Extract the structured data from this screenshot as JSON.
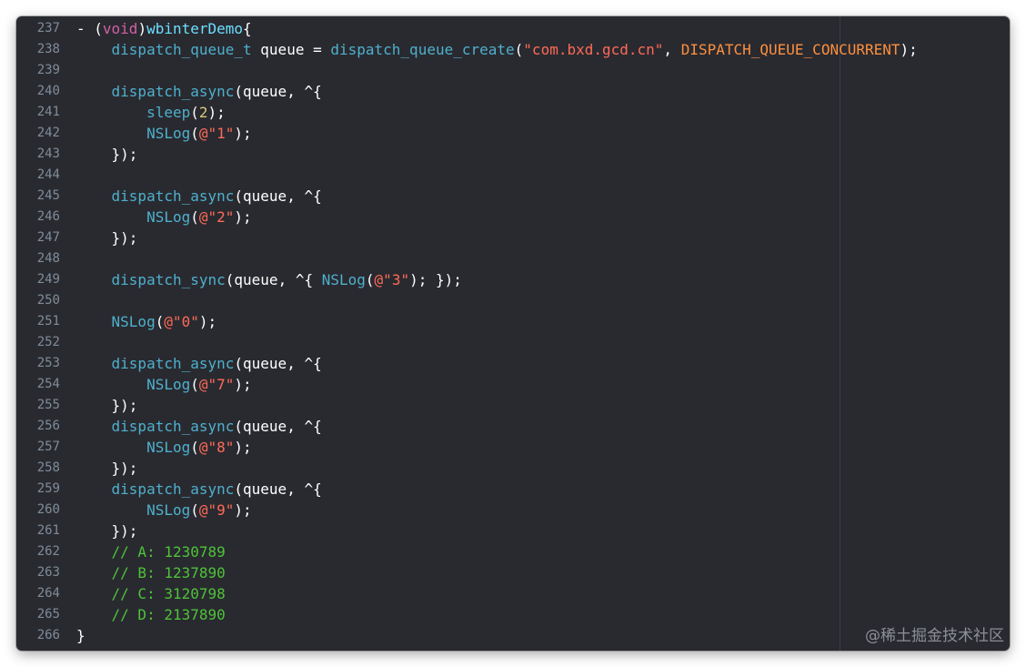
{
  "editor": {
    "watermark": "@稀土掘金技术社区",
    "colors": {
      "background": "#292a30",
      "line_number": "#7f8c98",
      "plain": "#ffffff",
      "function": "#4eb0cc",
      "keyword": "#d35fa8",
      "string": "#ff6a57",
      "number": "#d9c97c",
      "comment": "#4ec338",
      "macro": "#fd8f3f"
    },
    "lines": [
      {
        "n": "237",
        "tokens": [
          {
            "t": "- (",
            "c": "plain"
          },
          {
            "t": "void",
            "c": "keyword"
          },
          {
            "t": ")",
            "c": "plain"
          },
          {
            "t": "wbinterDemo",
            "c": "decl"
          },
          {
            "t": "{",
            "c": "plain"
          }
        ]
      },
      {
        "n": "238",
        "tokens": [
          {
            "t": "    ",
            "c": "plain"
          },
          {
            "t": "dispatch_queue_t",
            "c": "func"
          },
          {
            "t": " queue = ",
            "c": "plain"
          },
          {
            "t": "dispatch_queue_create",
            "c": "func"
          },
          {
            "t": "(",
            "c": "plain"
          },
          {
            "t": "\"com.bxd.gcd.cn\"",
            "c": "string"
          },
          {
            "t": ", ",
            "c": "plain"
          },
          {
            "t": "DISPATCH_QUEUE_CONCURRENT",
            "c": "macro"
          },
          {
            "t": ");",
            "c": "plain"
          }
        ]
      },
      {
        "n": "239",
        "tokens": []
      },
      {
        "n": "240",
        "tokens": [
          {
            "t": "    ",
            "c": "plain"
          },
          {
            "t": "dispatch_async",
            "c": "func"
          },
          {
            "t": "(queue, ^{",
            "c": "plain"
          }
        ]
      },
      {
        "n": "241",
        "tokens": [
          {
            "t": "        ",
            "c": "plain"
          },
          {
            "t": "sleep",
            "c": "func"
          },
          {
            "t": "(",
            "c": "plain"
          },
          {
            "t": "2",
            "c": "number"
          },
          {
            "t": ");",
            "c": "plain"
          }
        ]
      },
      {
        "n": "242",
        "tokens": [
          {
            "t": "        ",
            "c": "plain"
          },
          {
            "t": "NSLog",
            "c": "func"
          },
          {
            "t": "(",
            "c": "plain"
          },
          {
            "t": "@\"1\"",
            "c": "string"
          },
          {
            "t": ");",
            "c": "plain"
          }
        ]
      },
      {
        "n": "243",
        "tokens": [
          {
            "t": "    });",
            "c": "plain"
          }
        ]
      },
      {
        "n": "244",
        "tokens": []
      },
      {
        "n": "245",
        "tokens": [
          {
            "t": "    ",
            "c": "plain"
          },
          {
            "t": "dispatch_async",
            "c": "func"
          },
          {
            "t": "(queue, ^{",
            "c": "plain"
          }
        ]
      },
      {
        "n": "246",
        "tokens": [
          {
            "t": "        ",
            "c": "plain"
          },
          {
            "t": "NSLog",
            "c": "func"
          },
          {
            "t": "(",
            "c": "plain"
          },
          {
            "t": "@\"2\"",
            "c": "string"
          },
          {
            "t": ");",
            "c": "plain"
          }
        ]
      },
      {
        "n": "247",
        "tokens": [
          {
            "t": "    });",
            "c": "plain"
          }
        ]
      },
      {
        "n": "248",
        "tokens": []
      },
      {
        "n": "249",
        "tokens": [
          {
            "t": "    ",
            "c": "plain"
          },
          {
            "t": "dispatch_sync",
            "c": "func"
          },
          {
            "t": "(queue, ^{ ",
            "c": "plain"
          },
          {
            "t": "NSLog",
            "c": "func"
          },
          {
            "t": "(",
            "c": "plain"
          },
          {
            "t": "@\"3\"",
            "c": "string"
          },
          {
            "t": "); });",
            "c": "plain"
          }
        ]
      },
      {
        "n": "250",
        "tokens": []
      },
      {
        "n": "251",
        "tokens": [
          {
            "t": "    ",
            "c": "plain"
          },
          {
            "t": "NSLog",
            "c": "func"
          },
          {
            "t": "(",
            "c": "plain"
          },
          {
            "t": "@\"0\"",
            "c": "string"
          },
          {
            "t": ");",
            "c": "plain"
          }
        ]
      },
      {
        "n": "252",
        "tokens": []
      },
      {
        "n": "253",
        "tokens": [
          {
            "t": "    ",
            "c": "plain"
          },
          {
            "t": "dispatch_async",
            "c": "func"
          },
          {
            "t": "(queue, ^{",
            "c": "plain"
          }
        ]
      },
      {
        "n": "254",
        "tokens": [
          {
            "t": "        ",
            "c": "plain"
          },
          {
            "t": "NSLog",
            "c": "func"
          },
          {
            "t": "(",
            "c": "plain"
          },
          {
            "t": "@\"7\"",
            "c": "string"
          },
          {
            "t": ");",
            "c": "plain"
          }
        ]
      },
      {
        "n": "255",
        "tokens": [
          {
            "t": "    });",
            "c": "plain"
          }
        ]
      },
      {
        "n": "256",
        "tokens": [
          {
            "t": "    ",
            "c": "plain"
          },
          {
            "t": "dispatch_async",
            "c": "func"
          },
          {
            "t": "(queue, ^{",
            "c": "plain"
          }
        ]
      },
      {
        "n": "257",
        "tokens": [
          {
            "t": "        ",
            "c": "plain"
          },
          {
            "t": "NSLog",
            "c": "func"
          },
          {
            "t": "(",
            "c": "plain"
          },
          {
            "t": "@\"8\"",
            "c": "string"
          },
          {
            "t": ");",
            "c": "plain"
          }
        ]
      },
      {
        "n": "258",
        "tokens": [
          {
            "t": "    });",
            "c": "plain"
          }
        ]
      },
      {
        "n": "259",
        "tokens": [
          {
            "t": "    ",
            "c": "plain"
          },
          {
            "t": "dispatch_async",
            "c": "func"
          },
          {
            "t": "(queue, ^{",
            "c": "plain"
          }
        ]
      },
      {
        "n": "260",
        "tokens": [
          {
            "t": "        ",
            "c": "plain"
          },
          {
            "t": "NSLog",
            "c": "func"
          },
          {
            "t": "(",
            "c": "plain"
          },
          {
            "t": "@\"9\"",
            "c": "string"
          },
          {
            "t": ");",
            "c": "plain"
          }
        ]
      },
      {
        "n": "261",
        "tokens": [
          {
            "t": "    });",
            "c": "plain"
          }
        ]
      },
      {
        "n": "262",
        "tokens": [
          {
            "t": "    // A: 1230789",
            "c": "comment"
          }
        ]
      },
      {
        "n": "263",
        "tokens": [
          {
            "t": "    // B: 1237890",
            "c": "comment"
          }
        ]
      },
      {
        "n": "264",
        "tokens": [
          {
            "t": "    // C: 3120798",
            "c": "comment"
          }
        ]
      },
      {
        "n": "265",
        "tokens": [
          {
            "t": "    // D: 2137890",
            "c": "comment"
          }
        ]
      },
      {
        "n": "266",
        "tokens": [
          {
            "t": "}",
            "c": "plain"
          }
        ]
      }
    ]
  }
}
